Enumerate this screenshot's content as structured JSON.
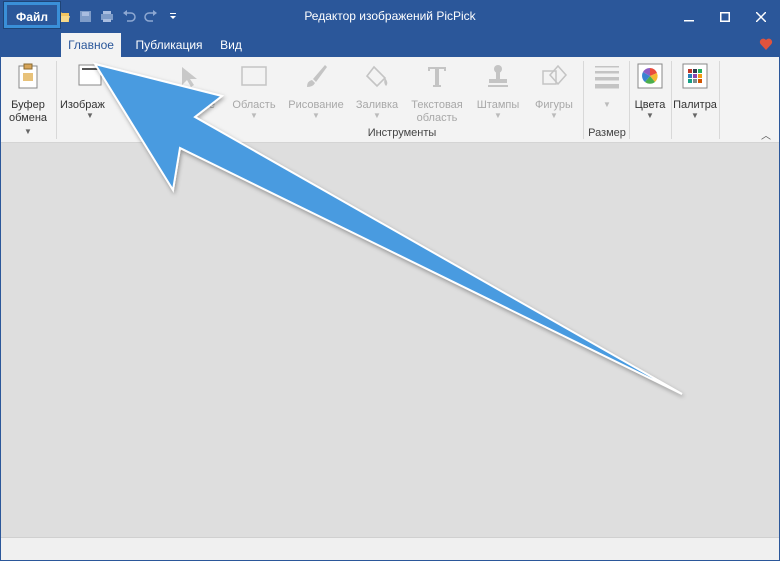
{
  "window": {
    "title": "Редактор изображений PicPick",
    "controls": [
      "minimize-icon",
      "maximize-icon",
      "close-icon"
    ]
  },
  "quick_access": [
    "new-file-icon",
    "open-folder-icon",
    "save-icon",
    "print-icon",
    "undo-icon",
    "redo-icon",
    "customize-icon"
  ],
  "tabs": {
    "file": "Файл",
    "home": "Главное",
    "publish": "Публикация",
    "view": "Вид"
  },
  "ribbon": {
    "clipboard": {
      "line1": "Буфер",
      "line2": "обмена"
    },
    "image": "Изображ",
    "select_partial": "е",
    "area": "Область",
    "drawing": "Рисование",
    "fill": "Заливка",
    "text": {
      "line1": "Текстовая",
      "line2": "область"
    },
    "stamps": "Штампы",
    "shapes": "Фигуры",
    "size": "Размер",
    "colors": "Цвета",
    "palette": "Палитра",
    "groups": {
      "tools": "Инструменты"
    }
  },
  "colors": {
    "titlebar": "#2b579a",
    "arrow": "#4a9be0",
    "heart": "#e0533d"
  }
}
